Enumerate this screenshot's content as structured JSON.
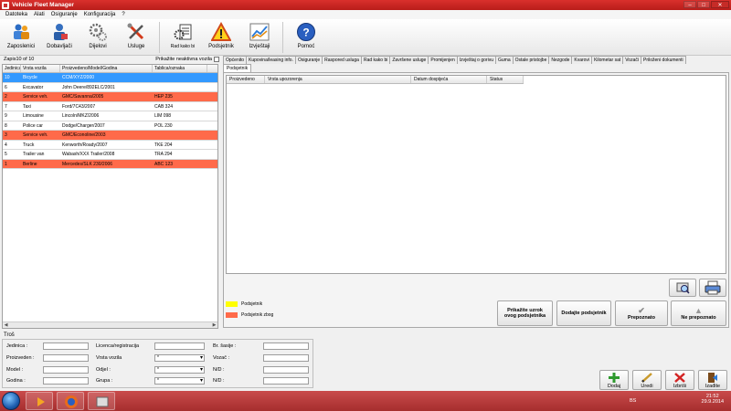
{
  "window": {
    "title": "Vehicle Fleet Manager"
  },
  "menu": [
    "Datoteka",
    "Alati",
    "Osiguranje",
    "Konfiguracija",
    "?"
  ],
  "toolbar": [
    {
      "label": "Zaposlenici",
      "icon": "employees-icon"
    },
    {
      "label": "Dobavljači",
      "icon": "suppliers-icon"
    },
    {
      "label": "Dijelovi",
      "icon": "parts-gears-icon"
    },
    {
      "label": "Usluge",
      "icon": "services-tools-icon"
    },
    {
      "label": "Rad kako bi",
      "icon": "work-order-icon"
    },
    {
      "label": "Podsjetnik",
      "icon": "warning-reminder-icon"
    },
    {
      "label": "Izvještaji",
      "icon": "reports-chart-icon"
    },
    {
      "label": "Pomoć",
      "icon": "help-icon"
    }
  ],
  "left_panel": {
    "record_count": "Zapis10 of 10",
    "show_inactive_label": "Prikažite neaktivna vozila",
    "columns": [
      "Jedinica",
      "Vrsta vozila",
      "Proizvedeno/Model/Godina",
      "Tablica/oznaka"
    ],
    "rows": [
      {
        "unit": "10",
        "type": "Bicycle",
        "model": "CCM/XYZ/2000",
        "plate": "",
        "state": "selected"
      },
      {
        "unit": "6",
        "type": "Excavator",
        "model": "John Deere/892ELC/2001",
        "plate": "",
        "state": "normal"
      },
      {
        "unit": "2",
        "type": "Service veh.",
        "model": "GMC/Savanna/2005",
        "plate": "HEP 235",
        "state": "red"
      },
      {
        "unit": "7",
        "type": "Taxi",
        "model": "Ford/7C43/2007",
        "plate": "CAB 324",
        "state": "normal"
      },
      {
        "unit": "9",
        "type": "Limousine",
        "model": "Lincoln/MKZ/2006",
        "plate": "LIM 098",
        "state": "normal"
      },
      {
        "unit": "8",
        "type": "Police car",
        "model": "Dodge/Charger/2007",
        "plate": "POL 230",
        "state": "normal"
      },
      {
        "unit": "3",
        "type": "Service veh.",
        "model": "GMC/Econoline/2003",
        "plate": "",
        "state": "red"
      },
      {
        "unit": "4",
        "type": "Truck",
        "model": "Kenworth/Roady/2007",
        "plate": "TKE 204",
        "state": "normal"
      },
      {
        "unit": "5",
        "type": "Trailer van",
        "model": "Wabash/XXX Trailer/2008",
        "plate": "TRA 294",
        "state": "normal"
      },
      {
        "unit": "1",
        "type": "Berline",
        "model": "Mercedes/SLK 230/2006",
        "plate": "ABC 123",
        "state": "red"
      }
    ]
  },
  "tabs": [
    "Općenito",
    "Kupovina/leasing info.",
    "Osiguranje",
    "Raspored usluga",
    "Rad kako bi",
    "Završene usluge",
    "Promijenjen",
    "Izvještaj o gorivu",
    "Guma",
    "Ostale pristojbe",
    "Nezgode",
    "Kvarovi",
    "Kilometar sat",
    "Vozači",
    "Priloženi dokumenti"
  ],
  "subtab": "Podsjetnik",
  "reminders_grid": {
    "columns": [
      "Proizvedeno",
      "Vrsta upozorenja",
      "Datum dospijeća",
      "Status"
    ]
  },
  "legend": [
    {
      "label": "Podsjetnik",
      "color": "#ffff00"
    },
    {
      "label": "Podsjetnik zbog",
      "color": "#ff6a4a"
    }
  ],
  "actions": {
    "show_reason": [
      "Prikažite uzrok",
      "ovog podsjetnika"
    ],
    "add_reminder": "Dodajte podsjetnik",
    "acknowledge": "Prepoznato",
    "not_acknowledged": "Ne prepoznato"
  },
  "costs": {
    "title": "Troš",
    "labels": {
      "unit": "Jedinica :",
      "made": "Proizveden :",
      "model": "Model :",
      "year": "Godina :",
      "license": "Licenca/registracija",
      "vehicle_type": "Vrsta vozila",
      "dept": "Odjel :",
      "group": "Grupa :",
      "chassis": "Br. šasije :",
      "driver": "Vozač :",
      "na1": "N/D :",
      "na2": "N/D :"
    },
    "select_value": "*"
  },
  "bottom_buttons": {
    "add": "Dodaj",
    "edit": "Uredi",
    "delete": "Izbriši",
    "exit": "Izađite"
  },
  "taskbar": {
    "lang": "BS",
    "time": "21:52",
    "date": "29.9.2014"
  }
}
